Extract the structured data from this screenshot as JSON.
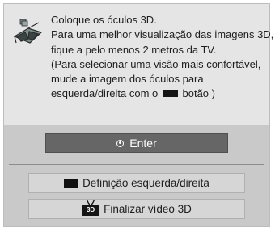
{
  "dialog": {
    "icon": "3d-glasses-icon",
    "message_lines": [
      "Coloque os óculos 3D.",
      "Para uma melhor visualização das imagens 3D,",
      "fique a pelo menos 2 metros da TV.",
      "(Para selecionar  uma visão mais confortável,",
      "mude a imagem dos óculos para",
      "esquerda/direita com o",
      "botão )"
    ],
    "enter_label": "Enter",
    "lr_label": "Definição esquerda/direita",
    "finish_label": "Finalizar vídeo 3D",
    "threed_key_label": "3D"
  }
}
